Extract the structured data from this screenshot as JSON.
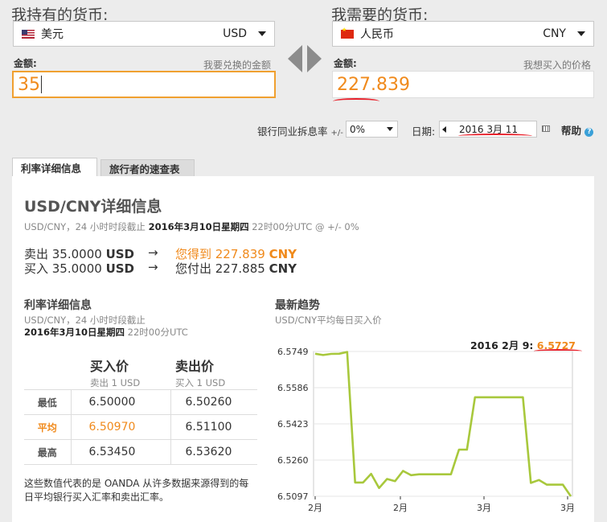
{
  "from": {
    "header": "我持有的货币:",
    "name": "美元",
    "code": "USD",
    "amount_label": "金额:",
    "amount_hint": "我要兑换的金额",
    "amount": "35"
  },
  "to": {
    "header": "我需要的货币:",
    "name": "人民币",
    "code": "CNY",
    "amount_label": "金额:",
    "amount_hint": "我想买入的价格",
    "amount": "227.839"
  },
  "options": {
    "interbank_label": "银行同业拆息率",
    "pm": "+/-",
    "rate_value": "0%",
    "date_label": "日期:",
    "date_value": "2016 3月 11",
    "help": "帮助"
  },
  "tabs": [
    "利率详细信息",
    "旅行者的速查表"
  ],
  "details": {
    "title": "USD/CNY详细信息",
    "sub_prefix": "USD/CNY，24 小时时段截止 ",
    "sub_date": "2016年3月10日星期四",
    "sub_suffix": " 22时00分UTC @ +/- 0%",
    "sell_line": {
      "a": "卖出 35.0000 ",
      "b": "USD",
      "c": "您得到 227.839 ",
      "d": "CNY"
    },
    "buy_line": {
      "a": "买入 35.0000 ",
      "b": "USD",
      "c": "您付出 227.885 ",
      "d": "CNY"
    },
    "arrow": "→"
  },
  "rates": {
    "title": "利率详细信息",
    "sub1": "USD/CNY，24 小时时段截止",
    "sub2_date": "2016年3月10日星期四",
    "sub2_time": " 22时00分UTC",
    "col_buy": "买入价",
    "col_buy_sub": "卖出 1 USD",
    "col_sell": "卖出价",
    "col_sell_sub": "买入 1 USD",
    "rows": [
      {
        "label": "最低",
        "buy": "6.50000",
        "sell": "6.50260"
      },
      {
        "label": "平均",
        "buy": "6.50970",
        "sell": "6.51100"
      },
      {
        "label": "最高",
        "buy": "6.53450",
        "sell": "6.53620"
      }
    ],
    "note": "这些数值代表的是 OANDA 从许多数据来源得到的每日平均银行买入汇率和卖出汇率。"
  },
  "trend": {
    "title": "最新趋势",
    "sub": "USD/CNY平均每日买入价",
    "point_label": "2016 2月 9:",
    "point_value": "6.5727"
  },
  "chart_data": {
    "type": "line",
    "ylim": [
      6.5097,
      6.5749
    ],
    "yticks": [
      "6.5749",
      "6.5586",
      "6.5423",
      "6.5260",
      "6.5097"
    ],
    "xticks": [
      "2月",
      "2月",
      "3月",
      "3月"
    ],
    "line_color": "#a8c83c",
    "series": [
      {
        "values": [
          6.5739,
          6.5733,
          6.5738,
          6.5739,
          6.5747,
          6.5159,
          6.5159,
          6.5198,
          6.5134,
          6.5175,
          6.5165,
          6.5211,
          6.5192,
          6.5196,
          6.5196,
          6.5196,
          6.5196,
          6.5196,
          6.5307,
          6.5307,
          6.5543,
          6.5543,
          6.5543,
          6.5543,
          6.5543,
          6.5543,
          6.5543,
          6.5157,
          6.517,
          6.5149,
          6.5149,
          6.5149,
          6.5097
        ]
      }
    ]
  }
}
